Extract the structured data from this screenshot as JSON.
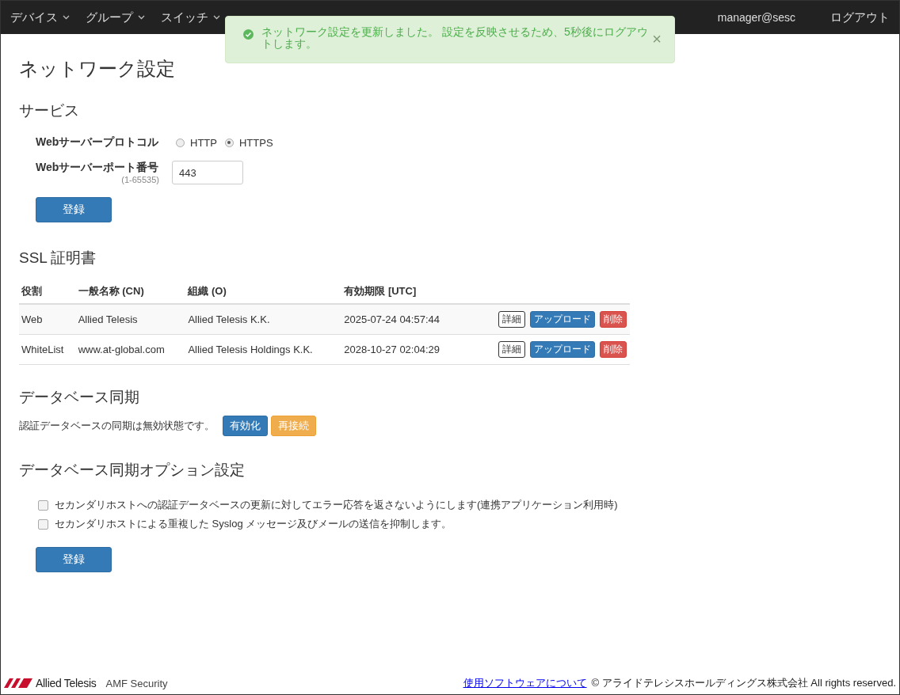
{
  "navbar": {
    "items": [
      {
        "label": "デバイス",
        "dropdown": true
      },
      {
        "label": "グループ",
        "dropdown": true
      },
      {
        "label": "スイッチ",
        "dropdown": true
      }
    ],
    "user": "manager@sesc",
    "logout": "ログアウト"
  },
  "alert": {
    "kind": "success",
    "message": "ネットワーク設定を更新しました。 設定を反映させるため、5秒後にログアウトします。",
    "close": "×"
  },
  "title": "ネットワーク設定",
  "service": {
    "heading": "サービス",
    "protocol_label": "Webサーバープロトコル",
    "protocols": [
      {
        "label": "HTTP",
        "selected": false
      },
      {
        "label": "HTTPS",
        "selected": true
      }
    ],
    "port_label": "Webサーバーポート番号",
    "port_hint": "(1-65535)",
    "port_value": "443",
    "submit": "登録"
  },
  "ssl": {
    "heading": "SSL 証明書",
    "columns": [
      "役割",
      "一般名称 (CN)",
      "組織 (O)",
      "有効期限 [UTC]"
    ],
    "rows": [
      {
        "cells": [
          "Web",
          "Allied Telesis",
          "Allied Telesis K.K.",
          "2025-07-24 04:57:44"
        ],
        "actions": [
          "詳細",
          "アップロード",
          "削除"
        ]
      },
      {
        "cells": [
          "WhiteList",
          "www.at-global.com",
          "Allied Telesis Holdings K.K.",
          "2028-10-27 02:04:29"
        ],
        "actions": [
          "詳細",
          "アップロード",
          "削除"
        ]
      }
    ]
  },
  "db_sync": {
    "heading": "データベース同期",
    "status": "認証データベースの同期は無効状態です。",
    "buttons": [
      {
        "label": "有効化",
        "kind": "primary"
      },
      {
        "label": "再接続",
        "kind": "warning"
      }
    ]
  },
  "db_options": {
    "heading": "データベース同期オプション設定",
    "options": [
      {
        "label": "セカンダリホストへの認証データベースの更新に対してエラー応答を返さないようにします(連携アプリケーション利用時)",
        "checked": false
      },
      {
        "label": "セカンダリホストによる重複した Syslog メッセージ及びメールの送信を抑制します。",
        "checked": false
      }
    ],
    "submit": "登録"
  },
  "footer": {
    "brand": "Allied Telesis",
    "product": "AMF Security",
    "link": "使用ソフトウェアについて",
    "copyright": "© アライドテレシスホールディングス株式会社 All rights reserved."
  }
}
